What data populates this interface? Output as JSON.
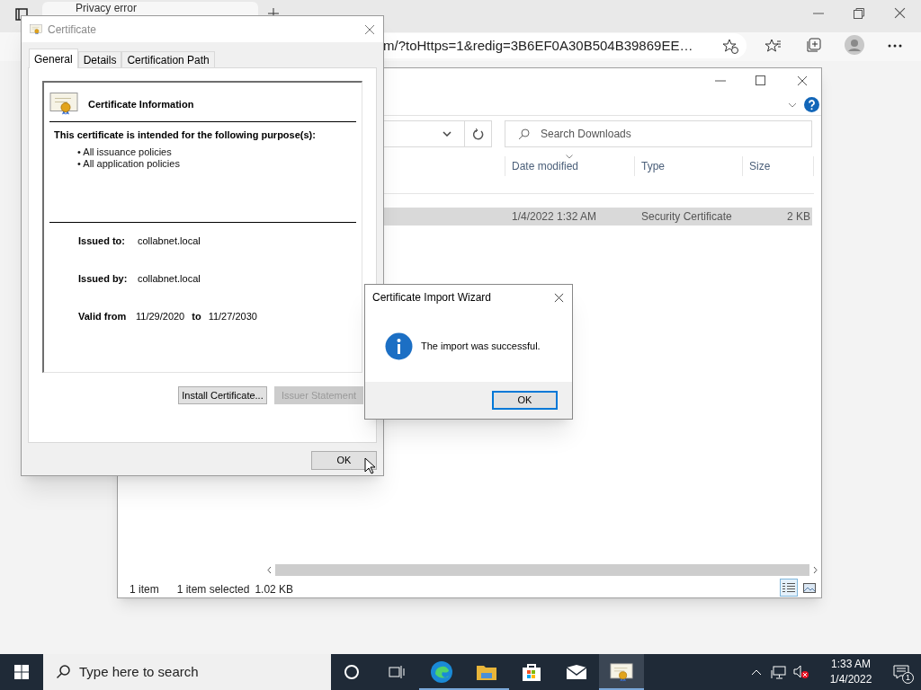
{
  "browser": {
    "tab_title": "Privacy error",
    "address": "m/?toHttps=1&redig=3B6EF0A30B504B39869EE…"
  },
  "explorer": {
    "search_placeholder": "Search Downloads",
    "columns": [
      "Date modified",
      "Type",
      "Size"
    ],
    "rows": [
      {
        "date": "1/4/2022 1:32 AM",
        "type": "Security Certificate",
        "size": "2 KB",
        "selected": true
      }
    ],
    "status": {
      "count": "1 item",
      "selection": "1 item selected",
      "size": "1.02 KB"
    },
    "views": [
      {
        "kind": "details",
        "selected": true
      },
      {
        "kind": "tiles",
        "selected": false
      }
    ]
  },
  "certificate": {
    "title": "Certificate",
    "tabs": [
      {
        "label": "General",
        "selected": true
      },
      {
        "label": "Details",
        "selected": false
      },
      {
        "label": "Certification Path",
        "selected": false
      }
    ],
    "heading": "Certificate Information",
    "purpose_title": "This certificate is intended for the following purpose(s):",
    "purposes": [
      "• All issuance policies",
      "• All application policies"
    ],
    "fields": [
      {
        "label": "Issued to:",
        "value": "collabnet.local"
      },
      {
        "label": "Issued by:",
        "value": "collabnet.local"
      }
    ],
    "valid": {
      "label": "Valid from",
      "from": "11/29/2020",
      "to_label": "to",
      "to": "11/27/2030"
    },
    "buttons": [
      {
        "label": "Install Certificate...",
        "disabled": false
      },
      {
        "label": "Issuer Statement",
        "disabled": true
      }
    ],
    "ok": "OK"
  },
  "wizard": {
    "title": "Certificate Import Wizard",
    "message": "The import was successful.",
    "ok": "OK"
  },
  "taskbar": {
    "search_placeholder": "Type here to search",
    "apps": [
      {
        "kind": "cortana",
        "running": false,
        "selected": false
      },
      {
        "kind": "taskview",
        "running": false,
        "selected": false
      },
      {
        "kind": "edge",
        "running": true,
        "selected": false
      },
      {
        "kind": "folder",
        "running": true,
        "selected": false
      },
      {
        "kind": "store",
        "running": false,
        "selected": false
      },
      {
        "kind": "mail",
        "running": false,
        "selected": false
      },
      {
        "kind": "certificate",
        "running": true,
        "selected": true
      }
    ],
    "time": "1:33 AM",
    "date": "1/4/2022",
    "notifications": "1"
  }
}
